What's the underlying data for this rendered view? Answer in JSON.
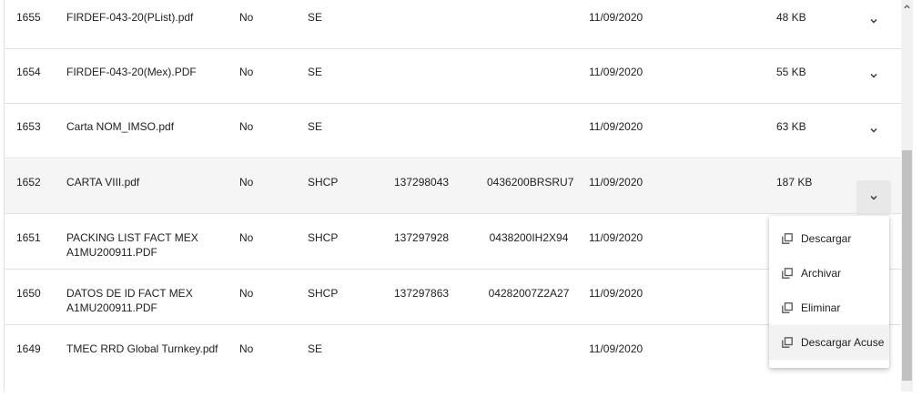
{
  "table": {
    "rows": [
      {
        "id": "1655",
        "name": "FIRDEF-043-20(PList).pdf",
        "flag": "No",
        "org": "SE",
        "num": "",
        "code": "",
        "date": "11/09/2020",
        "size": "48 KB"
      },
      {
        "id": "1654",
        "name": "FIRDEF-043-20(Mex).PDF",
        "flag": "No",
        "org": "SE",
        "num": "",
        "code": "",
        "date": "11/09/2020",
        "size": "55 KB"
      },
      {
        "id": "1653",
        "name": "Carta NOM_IMSO.pdf",
        "flag": "No",
        "org": "SE",
        "num": "",
        "code": "",
        "date": "11/09/2020",
        "size": "63 KB"
      },
      {
        "id": "1652",
        "name": "CARTA VIII.pdf",
        "flag": "No",
        "org": "SHCP",
        "num": "137298043",
        "code": "0436200BRSRU7",
        "date": "11/09/2020",
        "size": "187 KB"
      },
      {
        "id": "1651",
        "name": "PACKING LIST FACT MEX A1MU200911.PDF",
        "flag": "No",
        "org": "SHCP",
        "num": "137297928",
        "code": "0438200IH2X94",
        "date": "11/09/2020",
        "size": ""
      },
      {
        "id": "1650",
        "name": "DATOS DE ID FACT MEX A1MU200911.PDF",
        "flag": "No",
        "org": "SHCP",
        "num": "137297863",
        "code": "04282007Z2A27",
        "date": "11/09/2020",
        "size": ""
      },
      {
        "id": "1649",
        "name": "TMEC RRD Global Turnkey.pdf",
        "flag": "No",
        "org": "SE",
        "num": "",
        "code": "",
        "date": "11/09/2020",
        "size": ""
      }
    ]
  },
  "menu": {
    "items": [
      {
        "label": "Descargar"
      },
      {
        "label": "Archivar"
      },
      {
        "label": "Eliminar"
      },
      {
        "label": "Descargar Acuse"
      }
    ]
  },
  "icons": {
    "row_action": "chevron-down-icon",
    "menu_item": "copy-icon",
    "scroll_up": "chevron-up-icon"
  },
  "colors": {
    "divider": "#e0e0e0",
    "highlight_row": "#f5f5f5",
    "active_button": "#e8e8e8",
    "scroll_thumb": "#c1c1c1"
  }
}
